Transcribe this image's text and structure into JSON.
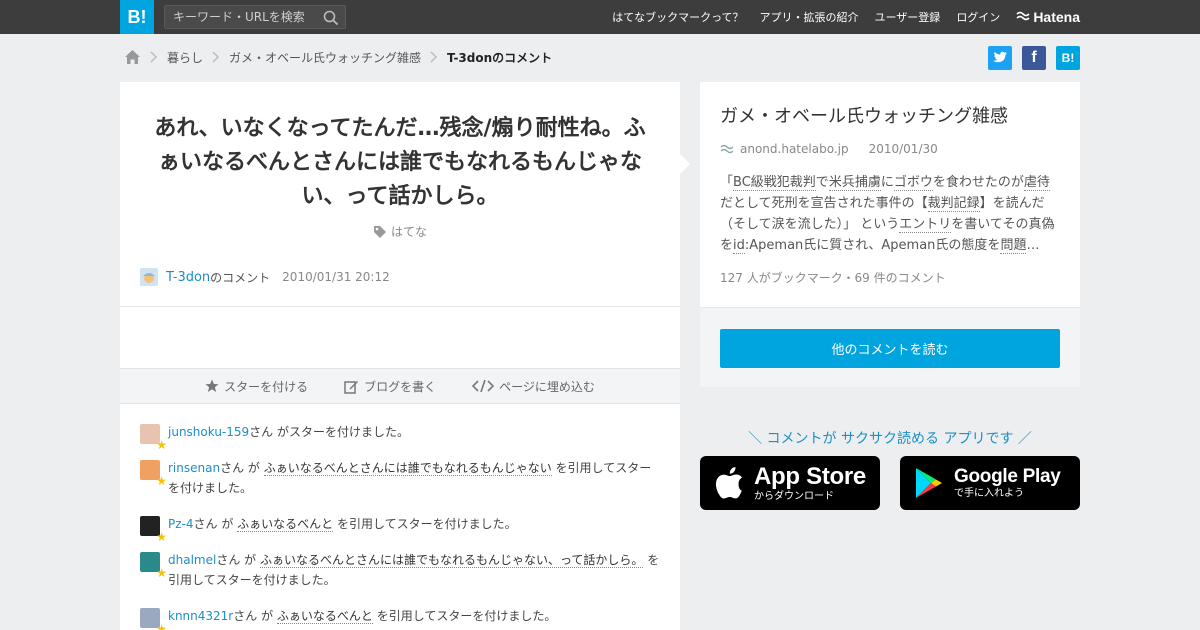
{
  "header": {
    "logo": "B!",
    "search_placeholder": "キーワード・URLを検索",
    "nav": [
      "はてなブックマークって？",
      "アプリ・拡張の紹介",
      "ユーザー登録",
      "ログイン"
    ],
    "hatena_label": "Hatena"
  },
  "breadcrumb": {
    "items": [
      "暮らし",
      "ガメ・オベール氏ウォッチング雑感"
    ],
    "current": "T-3donのコメント"
  },
  "share": {
    "hatena_label": "B!",
    "facebook_label": "f"
  },
  "comment": {
    "text": "あれ、いなくなってたんだ…残念/煽り耐性ね。ふぁいなるべんとさんには誰でもなれるもんじゃない、って話かしら。",
    "tag": "はてな",
    "user": "T-3don",
    "user_suffix": "のコメント",
    "date": "2010/01/31 20:12"
  },
  "actions": {
    "star": "スターを付ける",
    "blog": "ブログを書く",
    "embed": "ページに埋め込む"
  },
  "stars": [
    {
      "user": "junshoku-159",
      "pre": "さん がスターを付けました。",
      "quote": "",
      "post": "",
      "avatar_color": "#e8c4b0"
    },
    {
      "user": "rinsenan",
      "pre": "さん が ",
      "quote": "ふぁいなるべんとさんには誰でもなれるもんじゃない",
      "post": " を引用してスターを付けました。",
      "avatar_color": "#f0a060"
    },
    {
      "user": "Pz-4",
      "pre": "さん が ",
      "quote": "ふぁいなるべんと",
      "post": " を引用してスターを付けました。",
      "avatar_color": "#222222"
    },
    {
      "user": "dhalmel",
      "pre": "さん が ",
      "quote": "ふぁいなるべんとさんには誰でもなれるもんじゃない、って話かしら。",
      "post": " を引用してスターを付けました。",
      "avatar_color": "#2a8a8a"
    },
    {
      "user": "knnn4321r",
      "pre": "さん が ",
      "quote": "ふぁいなるべんと",
      "post": " を引用してスターを付けました。",
      "avatar_color": "#9aa8c0"
    }
  ],
  "star_glyph": "★",
  "side": {
    "title": "ガメ・オベール氏ウォッチング雑感",
    "domain": "anond.hatelabo.jp",
    "date": "2010/01/30",
    "summary_parts": [
      "「",
      "BC級戦犯裁判",
      "で",
      "米兵捕虜",
      "に",
      "ゴボウ",
      "を食わせたのが",
      "虐待",
      "だとして死刑を宣告された事件の【",
      "裁判記録",
      "】を読んだ（そして涙を流した）」 という",
      "エントリ",
      "を書いてその真偽を",
      "id",
      ":Apeman氏に質され、Apeman氏の態度を",
      "問題",
      "…"
    ],
    "counts": "127 人がブックマーク・69 件のコメント",
    "button": "他のコメントを読む"
  },
  "promo": {
    "text": "＼ コメントが サクサク読める アプリです ／",
    "appstore_big": "App Store",
    "appstore_small": "からダウンロード",
    "gplay_big": "Google Play",
    "gplay_small": "で手に入れよう"
  },
  "colors": {
    "accent": "#00a4de",
    "link": "#1c8fc7",
    "topbar": "#3d3d3d",
    "star": "#f5c400"
  }
}
